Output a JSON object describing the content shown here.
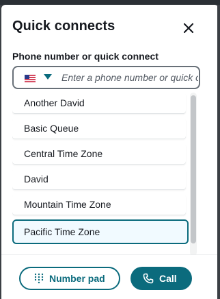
{
  "header": {
    "title": "Quick connects",
    "close_icon": "close-icon"
  },
  "search": {
    "label": "Phone number or quick connect",
    "country_flag": "us-flag-icon",
    "placeholder": "Enter a phone number or quick connect",
    "value": ""
  },
  "quick_connects": [
    {
      "label": "Another David",
      "selected": false
    },
    {
      "label": "Basic Queue",
      "selected": false
    },
    {
      "label": "Central Time Zone",
      "selected": false
    },
    {
      "label": "David",
      "selected": false
    },
    {
      "label": "Mountain Time Zone",
      "selected": false
    },
    {
      "label": "Pacific Time Zone",
      "selected": true
    }
  ],
  "footer": {
    "numpad_label": "Number pad",
    "numpad_icon": "keypad-icon",
    "call_label": "Call",
    "call_icon": "phone-icon"
  },
  "colors": {
    "accent": "#0b6b7d",
    "text": "#16191f",
    "selected_bg": "#f1faff"
  }
}
